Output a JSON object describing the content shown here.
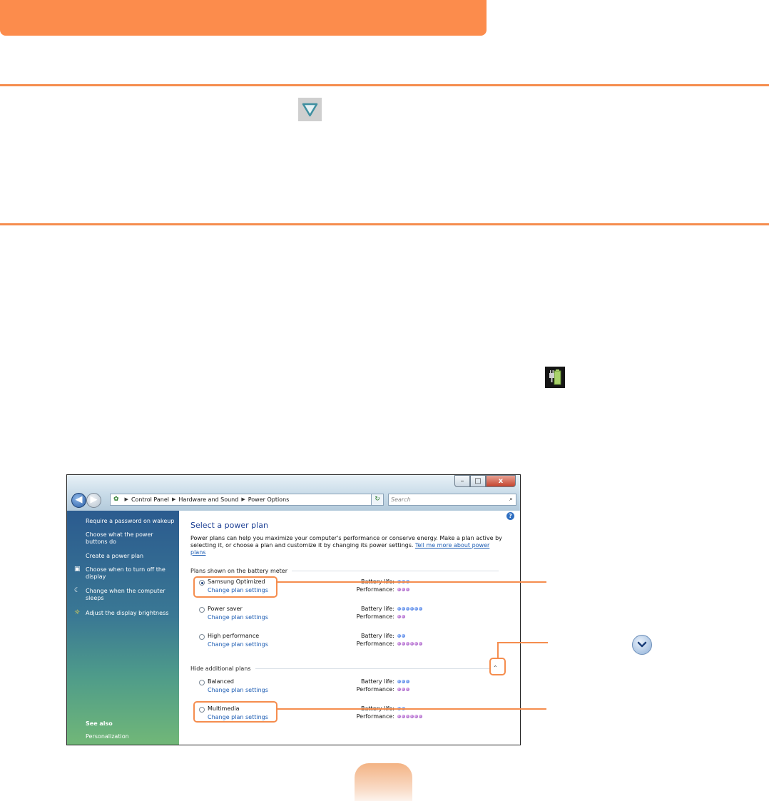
{
  "window": {
    "title_buttons": {
      "minimize": "–",
      "maximize": "□",
      "close": "x"
    },
    "address": {
      "segments": [
        "Control Panel",
        "Hardware and Sound",
        "Power Options"
      ]
    },
    "search_placeholder": "Search",
    "refresh_glyph": "↻",
    "search_glyph": "⌕",
    "back_glyph": "◀",
    "forward_glyph": "▶",
    "dropdown_glyph": "▾",
    "help_glyph": "?"
  },
  "left_pane": {
    "items": [
      {
        "label": "Require a password on wakeup",
        "icon": ""
      },
      {
        "label": "Choose what the power buttons do",
        "icon": ""
      },
      {
        "label": "Create a power plan",
        "icon": ""
      },
      {
        "label": "Choose when to turn off the display",
        "icon": "monitor-icon"
      },
      {
        "label": "Change when the computer sleeps",
        "icon": "moon-icon"
      },
      {
        "label": "Adjust the display brightness",
        "icon": "sun-icon"
      }
    ],
    "see_also": "See also",
    "personalization": "Personalization"
  },
  "content": {
    "title": "Select a power plan",
    "description": "Power plans can help you maximize your computer's performance or conserve energy. Make a plan active by selecting it, or choose a plan and customize it by changing its power settings.",
    "description_link": "Tell me more about power plans",
    "section_battery": "Plans shown on the battery meter",
    "section_hide": "Hide additional plans",
    "battery_label": "Battery life:",
    "performance_label": "Performance:",
    "change_link": "Change plan settings",
    "plans": [
      {
        "name": "Samsung Optimized",
        "selected": true,
        "battery": 3,
        "performance": 3
      },
      {
        "name": "Power saver",
        "selected": false,
        "battery": 6,
        "performance": 2
      },
      {
        "name": "High performance",
        "selected": false,
        "battery": 2,
        "performance": 6
      },
      {
        "name": "Balanced",
        "selected": false,
        "battery": 3,
        "performance": 3
      },
      {
        "name": "Multimedia",
        "selected": false,
        "battery": 2,
        "performance": 6
      }
    ]
  },
  "colors": {
    "accent": "#f58d4e",
    "battery_dot": "#2d63d8",
    "performance_dot": "#8a3fb3"
  }
}
